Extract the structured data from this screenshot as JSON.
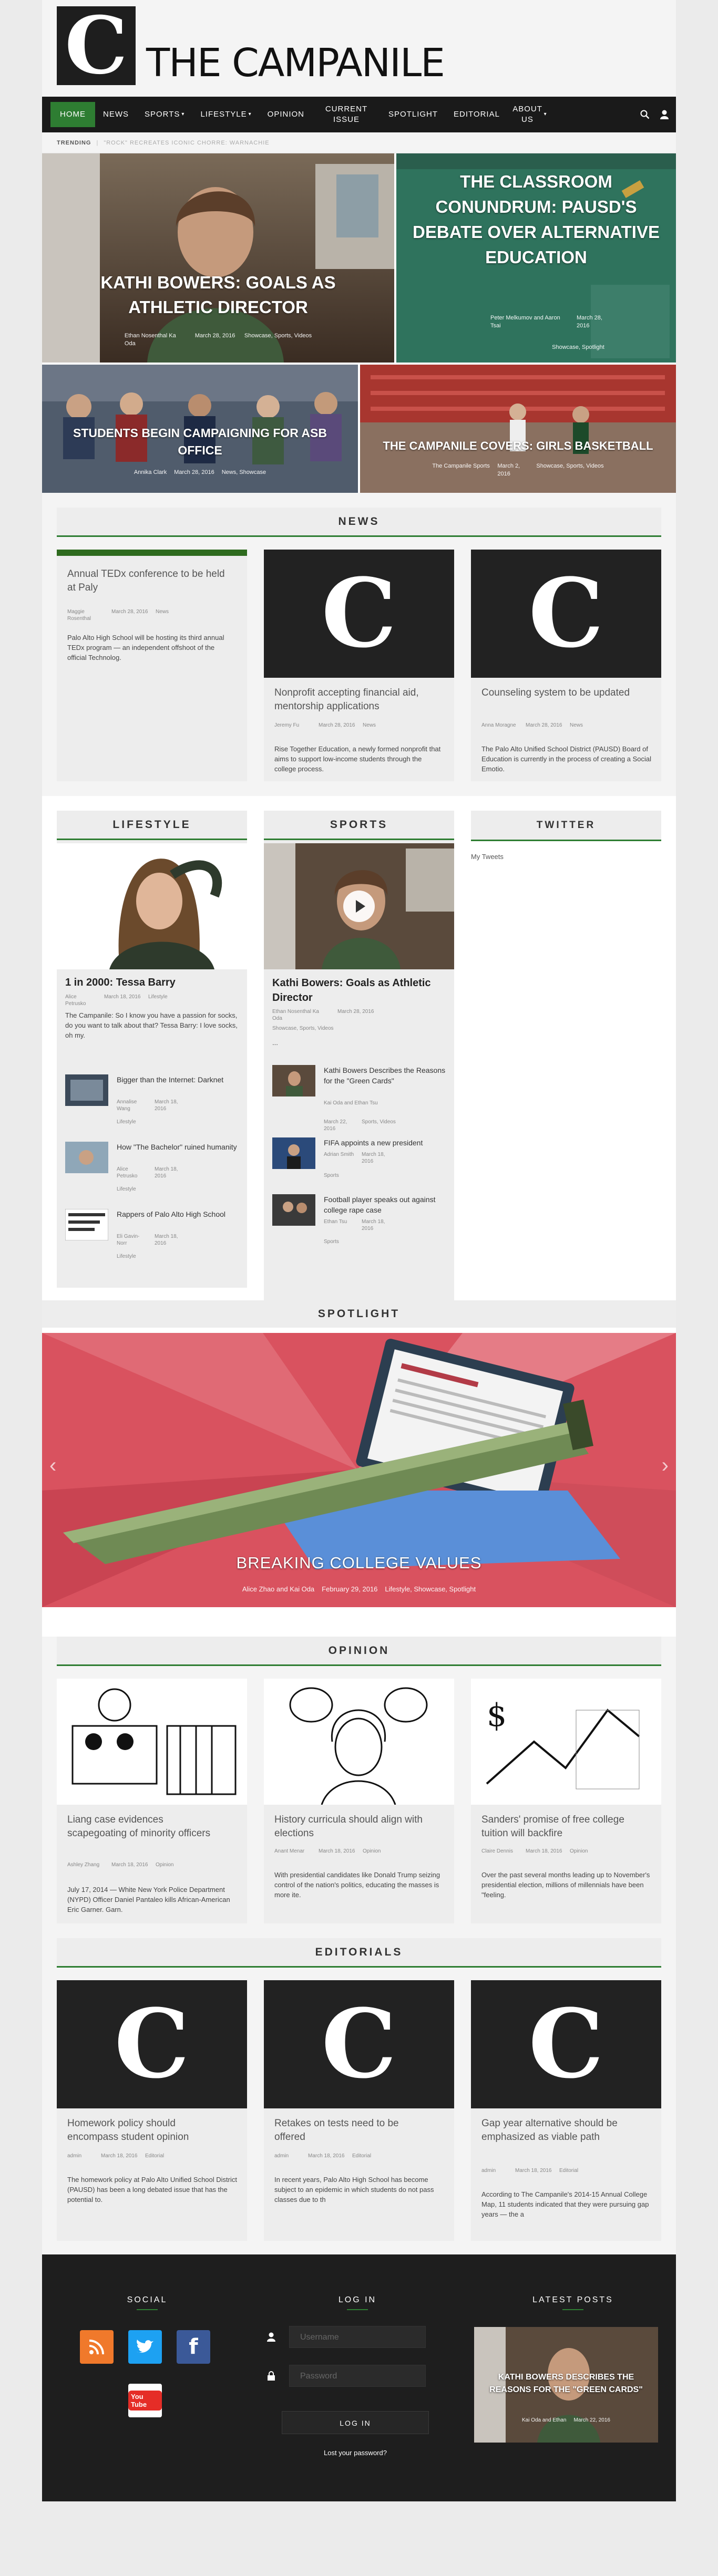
{
  "site": {
    "logo_letter": "C",
    "title": "THE CAMPANILE"
  },
  "nav": {
    "items": [
      "HOME",
      "NEWS",
      "SPORTS",
      "LIFESTYLE",
      "OPINION",
      "CURRENT ISSUE",
      "SPOTLIGHT",
      "EDITORIAL",
      "ABOUT US"
    ],
    "active": "HOME",
    "search_icon": "search-icon",
    "user_icon": "user-icon"
  },
  "trending": {
    "label": "TRENDING",
    "text": "\"ROCK\" RECREATES ICONIC CHORRE: WARNACHIE"
  },
  "hero": {
    "main": {
      "title": "KATHI BOWERS: GOALS AS ATHLETIC DIRECTOR",
      "author": "Ethan Nosenthal Ka Oda",
      "date": "March 28, 2016",
      "tags": "Showcase, Sports, Videos"
    },
    "side": {
      "title": "THE CLASSROOM CONUNDRUM: PAUSD'S DEBATE OVER ALTERNATIVE EDUCATION",
      "author": "Peter Melkumov and Aaron Tsai",
      "date": "March 28, 2016",
      "tags": "Showcase, Spotlight"
    },
    "left": {
      "title": "STUDENTS BEGIN CAMPAIGNING FOR ASB OFFICE",
      "author": "Annika Clark",
      "date": "March 28, 2016",
      "tags": "News, Showcase"
    },
    "right": {
      "title": "THE CAMPANILE COVERS: GIRLS BASKETBALL",
      "author": "The Campanile Sports",
      "date": "March 2, 2016",
      "tags": "Showcase, Sports, Videos"
    }
  },
  "news": {
    "heading": "NEWS",
    "articles": [
      {
        "title": "Annual TEDx conference to be held at Paly",
        "author": "Maggie Rosenthal",
        "date": "March 28, 2016",
        "category": "News",
        "excerpt": "Palo Alto High School will be hosting its third annual TEDx program — an independent offshoot of the official Technolog."
      },
      {
        "title": "Nonprofit accepting financial aid, mentorship applications",
        "author": "Jeremy Fu",
        "date": "March 28, 2016",
        "category": "News",
        "excerpt": "Rise Together Education, a newly formed nonprofit that aims to support low-income students through the college process."
      },
      {
        "title": "Counseling system to be updated",
        "author": "Anna Moragne",
        "date": "March 28, 2016",
        "category": "News",
        "excerpt": "The Palo Alto Unified School District (PAUSD) Board of Education is currently in the process of creating a Social Emotio."
      }
    ]
  },
  "lifestyle": {
    "heading": "LIFESTYLE",
    "main": {
      "title": "1 in 2000: Tessa Barry",
      "author": "Alice Petrusko",
      "date": "March 18, 2016",
      "category": "Lifestyle",
      "excerpt": "The Campanile: So I know you have a passion for socks, do you want to talk about that? Tessa Barry: I love socks, oh my."
    },
    "items": [
      {
        "title": "Bigger than the Internet: Darknet",
        "author": "Annalise Wang",
        "date": "March 18, 2016",
        "category": "Lifestyle"
      },
      {
        "title": "How \"The Bachelor\" ruined humanity",
        "author": "Alice Petrusko",
        "date": "March 18, 2016",
        "category": "Lifestyle"
      },
      {
        "title": "Rappers of Palo Alto High School",
        "author": "Eli Gavin-Norr",
        "date": "March 18, 2016",
        "category": "Lifestyle"
      }
    ]
  },
  "sports": {
    "heading": "SPORTS",
    "main": {
      "title": "Kathi Bowers: Goals as Athletic Director",
      "author": "Ethan Nosenthal Ka Oda",
      "date": "March 28, 2016",
      "category": "Showcase, Sports, Videos",
      "excerpt": "..."
    },
    "items": [
      {
        "title": "Kathi Bowers Describes the Reasons for the \"Green Cards\"",
        "author": "Kai Oda and Ethan Tsu",
        "date": "March 22, 2016",
        "category": "Sports, Videos"
      },
      {
        "title": "FIFA appoints a new president",
        "author": "Adrian Smith",
        "date": "March 18, 2016",
        "category": "Sports"
      },
      {
        "title": "Football player speaks out against college rape case",
        "author": "Ethan Tsu",
        "date": "March 18, 2016",
        "category": "Sports"
      }
    ]
  },
  "twitter": {
    "heading": "TWITTER",
    "link": "My Tweets"
  },
  "spotlight": {
    "heading": "SPOTLIGHT",
    "title": "BREAKING COLLEGE VALUES",
    "author": "Alice Zhao and Kai Oda",
    "date": "February 29, 2016",
    "tags": "Lifestyle, Showcase, Spotlight",
    "prev": "‹",
    "next": "›"
  },
  "opinion": {
    "heading": "OPINION",
    "articles": [
      {
        "title": "Liang case evidences scapegoating of minority officers",
        "author": "Ashley Zhang",
        "date": "March 18, 2016",
        "category": "Opinion",
        "excerpt": "July 17, 2014 — White New York Police Department (NYPD) Officer Daniel Pantaleo kills African-American Eric Garner. Garn."
      },
      {
        "title": "History curricula should align with elections",
        "author": "Anant Menar",
        "date": "March 18, 2016",
        "category": "Opinion",
        "excerpt": "With presidential candidates like Donald Trump seizing control of the nation's politics, educating the masses is more ite."
      },
      {
        "title": "Sanders' promise of free college tuition will backfire",
        "author": "Claire Dennis",
        "date": "March 18, 2016",
        "category": "Opinion",
        "excerpt": "Over the past several months leading up to November's presidential election, millions of millennials have been \"feeling."
      }
    ]
  },
  "editorials": {
    "heading": "EDITORIALS",
    "articles": [
      {
        "title": "Homework policy should encompass student opinion",
        "author": "admin",
        "date": "March 18, 2016",
        "category": "Editorial",
        "excerpt": "The homework policy at Palo Alto Unified School District (PAUSD) has been a long debated issue that has the potential to."
      },
      {
        "title": "Retakes on tests need to be offered",
        "author": "admin",
        "date": "March 18, 2016",
        "category": "Editorial",
        "excerpt": "In recent years, Palo Alto High School has become subject to an epidemic in which students do not pass classes due to th"
      },
      {
        "title": "Gap year alternative should be emphasized as viable path",
        "author": "admin",
        "date": "March 18, 2016",
        "category": "Editorial",
        "excerpt": "According to The Campanile's 2014-15 Annual College Map, 11 students indicated that they were pursuing gap years — the a"
      }
    ]
  },
  "footer": {
    "social_heading": "SOCIAL",
    "login_heading": "LOG IN",
    "latest_heading": "LATEST POSTS",
    "username_placeholder": "Username",
    "password_placeholder": "Password",
    "login_button": "LOG IN",
    "lost_password": "Lost your password?",
    "latest": {
      "title": "KATHI BOWERS DESCRIBES THE REASONS FOR THE \"GREEN CARDS\"",
      "author": "Kai Oda and Ethan",
      "date": "March 22, 2016"
    },
    "social": [
      "rss-icon",
      "twitter-icon",
      "facebook-icon",
      "youtube-icon"
    ],
    "youtube_label": "You Tube"
  },
  "colors": {
    "accent": "#2e7d32",
    "nav_bg": "#1a1a1a",
    "footer_bg": "#1e1e1e"
  }
}
